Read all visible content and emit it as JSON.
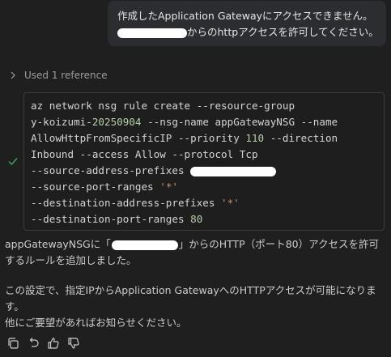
{
  "user_message": {
    "line1": "作成したApplication Gatewayにアクセスできません。",
    "line2_suffix": "からのhttpアクセスを許可してください。"
  },
  "reference": {
    "label": "Used 1 reference",
    "icon": "chevron-right-icon"
  },
  "status_icon": "checkmark-icon",
  "code": {
    "l1": "az network nsg rule create --resource-group",
    "l2_pre": "y-koizumi-",
    "l2_num": "20250904",
    "l2_post": " --nsg-name appGatewayNSG --name",
    "l3_pre": "AllowHttpFromSpecificIP --priority ",
    "l3_num": "110",
    "l3_post": " --direction",
    "l4": "Inbound --access Allow --protocol Tcp",
    "l5": "--source-address-prefixes ",
    "l6_pre": "--source-port-ranges ",
    "l6_str": "'*'",
    "l7_pre": "--destination-address-prefixes ",
    "l7_str": "'*'",
    "l8_pre": "--destination-port-ranges ",
    "l8_num": "80"
  },
  "response": {
    "p1_pre": "appGatewayNSGに「",
    "p1_post": "」からのHTTP（ポート80）アクセスを許可するルールを追加しました。",
    "p2_l1": "この設定で、指定IPからApplication GatewayへのHTTPアクセスが可能になります。",
    "p2_l2": "他にご要望があればお知らせください。"
  },
  "actions": [
    "copy-icon",
    "retry-icon",
    "thumbs-up-icon",
    "thumbs-down-icon"
  ],
  "colors": {
    "background": "#1f1f1f",
    "bubble": "#2b2d31",
    "code_number": "#b5cea8",
    "code_string": "#ce9178",
    "check": "#3fa564"
  }
}
